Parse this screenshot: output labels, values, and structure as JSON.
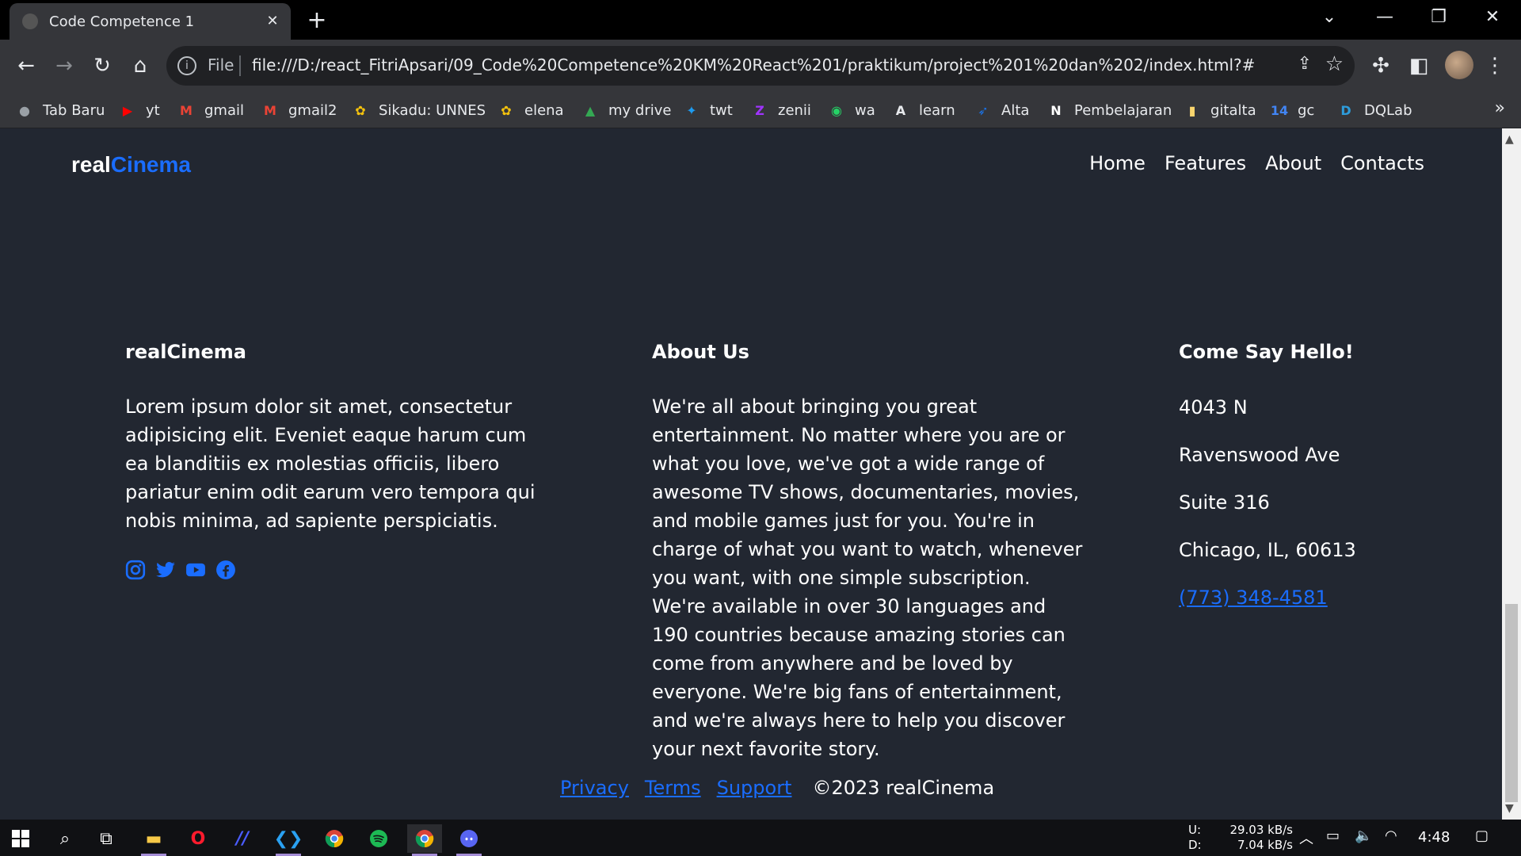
{
  "browser": {
    "tab_title": "Code Competence 1",
    "url_scheme": "File",
    "url": "file:///D:/react_FitriApsari/09_Code%20Competence%20KM%20React%201/praktikum/project%201%20dan%202/index.html?#"
  },
  "bookmarks": [
    {
      "label": "Tab Baru",
      "icon": "globe-icon",
      "color": "#9aa0a6"
    },
    {
      "label": "yt",
      "icon": "youtube-icon",
      "color": "#ff0000"
    },
    {
      "label": "gmail",
      "icon": "gmail-icon",
      "color": "#ea4335"
    },
    {
      "label": "gmail2",
      "icon": "gmail-icon",
      "color": "#ea4335"
    },
    {
      "label": "Sikadu: UNNES",
      "icon": "unnes-icon",
      "color": "#f4c20d"
    },
    {
      "label": "elena",
      "icon": "unnes-icon",
      "color": "#f4c20d"
    },
    {
      "label": "my drive",
      "icon": "drive-icon",
      "color": "#34a853"
    },
    {
      "label": "twt",
      "icon": "twitter-icon",
      "color": "#1d9bf0"
    },
    {
      "label": "zenii",
      "icon": "zenius-icon",
      "color": "#a033ff"
    },
    {
      "label": "wa",
      "icon": "whatsapp-icon",
      "color": "#25d366"
    },
    {
      "label": "learn",
      "icon": "learn-icon",
      "color": "#e8eaed"
    },
    {
      "label": "Alta",
      "icon": "alta-icon",
      "color": "#1a73e8"
    },
    {
      "label": "Pembelajaran",
      "icon": "notion-icon",
      "color": "#ffffff"
    },
    {
      "label": "gitalta",
      "icon": "folder-icon",
      "color": "#f9d56e"
    },
    {
      "label": "gc",
      "icon": "calendar-icon",
      "color": "#4285f4"
    },
    {
      "label": "DQLab",
      "icon": "dqlab-icon",
      "color": "#2d9cdb"
    }
  ],
  "site": {
    "brand_part1": "real",
    "brand_part2": "Cinema",
    "nav": [
      "Home",
      "Features",
      "About",
      "Contacts"
    ],
    "col1": {
      "title": "realCinema",
      "text": "Lorem ipsum dolor sit amet, consectetur adipisicing elit. Eveniet eaque harum cum ea blanditiis ex molestias officiis, libero pariatur enim odit earum vero tempora qui nobis minima, ad sapiente perspiciatis."
    },
    "col2": {
      "title": "About Us",
      "text": "We're all about bringing you great entertainment. No matter where you are or what you love, we've got a wide range of awesome TV shows, documentaries, movies, and mobile games just for you. You're in charge of what you want to watch, whenever you want, with one simple subscription. We're available in over 30 languages and 190 countries because amazing stories can come from anywhere and be loved by everyone. We're big fans of entertainment, and we're always here to help you discover your next favorite story."
    },
    "col3": {
      "title": "Come Say Hello!",
      "address_lines": [
        "4043 N",
        "Ravenswood Ave",
        "Suite 316",
        "Chicago, IL, 60613"
      ],
      "phone": "(773) 348-4581"
    },
    "footer": {
      "links": [
        "Privacy",
        "Terms",
        "Support"
      ],
      "copyright": "©2023 realCinema"
    },
    "accent_color": "#1a6dff"
  },
  "taskbar": {
    "net_up_label": "U:",
    "net_down_label": "D:",
    "net_up": "29.03 kB/s",
    "net_down": "7.04 kB/s",
    "time": "4:48"
  }
}
